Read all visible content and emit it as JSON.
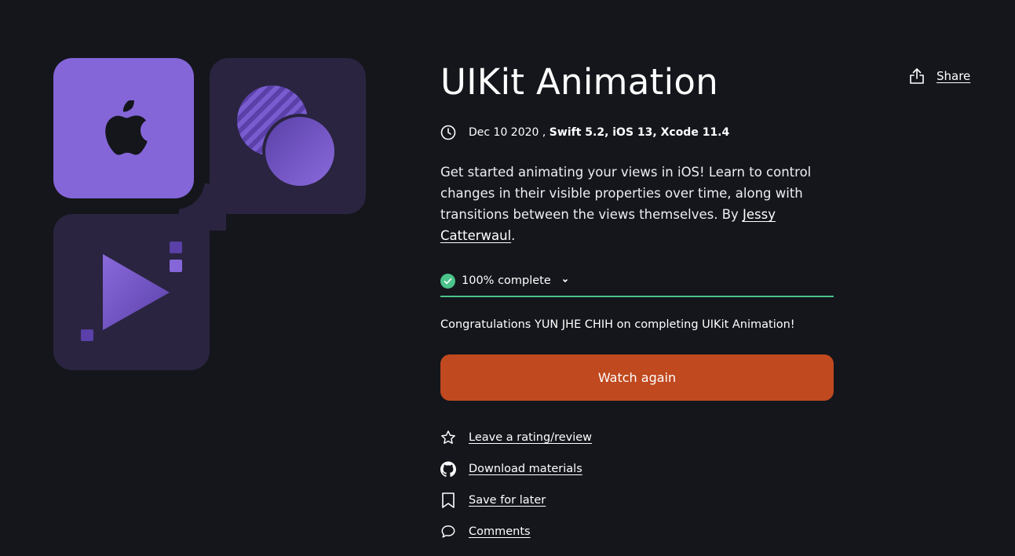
{
  "course": {
    "title": "UIKit Animation",
    "date": "Dec 10 2020",
    "separator": " ,",
    "tech": "Swift 5.2, iOS 13, Xcode 11.4",
    "description": "Get started animating your views in iOS! Learn to control changes in their visible properties over time, along with transitions between the views themselves. By ",
    "author": "Jessy Catterwaul",
    "description_end": "."
  },
  "share": {
    "label": "Share",
    "icon": "share-icon"
  },
  "progress": {
    "label": "100% complete",
    "fraction": 1.0,
    "color": "#4cc38a",
    "icon": "check-circle-icon"
  },
  "congrats": "Congratulations YUN JHE CHIH on completing UIKit Animation!",
  "watch_button": {
    "label": "Watch again",
    "color": "#c0491f"
  },
  "actions": [
    {
      "label": "Leave a rating/review",
      "icon": "star-icon"
    },
    {
      "label": "Download materials",
      "icon": "github-icon"
    },
    {
      "label": "Save for later",
      "icon": "bookmark-icon"
    },
    {
      "label": "Comments",
      "icon": "comment-icon"
    }
  ],
  "colors": {
    "background": "#14161c",
    "accent_purple": "#8566d8",
    "tile_dark": "#2a2440"
  }
}
